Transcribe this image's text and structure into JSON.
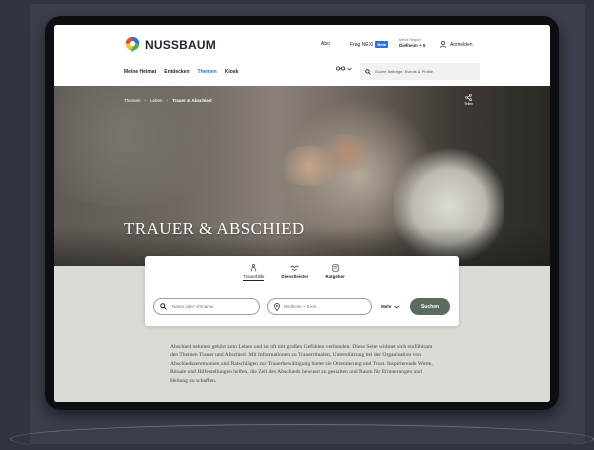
{
  "brand": {
    "name": "NUSSBAUM",
    "colors": {
      "blue": "#2d6fd6",
      "red": "#e04b3a",
      "green": "#4caf50",
      "yellow": "#f2c230"
    }
  },
  "topnav": {
    "abo": "Abo",
    "frag_label": "Frag NEXI",
    "frag_badge": "Beta",
    "region_small": "Meine Region",
    "region_big": "Dielheim + 5",
    "login": "Anmelden"
  },
  "menu": [
    {
      "label": "Meine Heimat",
      "active": false
    },
    {
      "label": "Entdecken",
      "active": false
    },
    {
      "label": "Themen",
      "active": true
    },
    {
      "label": "Kiosk",
      "active": false
    }
  ],
  "search_top": {
    "placeholder": "Suche Beiträge, Events & Profile"
  },
  "breadcrumb": [
    "Themen",
    "Leben",
    "Trauer & Abschied"
  ],
  "share_label": "Teilen",
  "hero_title": "TRAUER & ABSCHIED",
  "tabs": [
    {
      "label": "Trauerfälle",
      "icon": "person-icon",
      "active": true
    },
    {
      "label": "Dienstleister",
      "icon": "handshake-icon",
      "active": false
    },
    {
      "label": "Ratgeber",
      "icon": "book-icon",
      "active": false
    }
  ],
  "search_fields": {
    "name_placeholder": "Name oder Vorname",
    "location_value": "Dielheim + 5 km",
    "sort_label": "Mehr",
    "submit": "Suchen"
  },
  "description": "Abschied nehmen gehört zum Leben und ist oft mit großen Gefühlen verbunden. Diese Seite widmet sich einfühlsam den Themen Trauer und Abschied. Mit Informationen zu Trauerritualen, Unterstützung bei der Organisation von Abschiedszeremonien und Ratschlägen zur Trauerbewältigung bietet sie Orientierung und Trost. Inspirierende Worte, Rituale und Hilfestellungen helfen, die Zeit des Abschieds bewusst zu gestalten und Raum für Erinnerungen und Heilung zu schaffen."
}
